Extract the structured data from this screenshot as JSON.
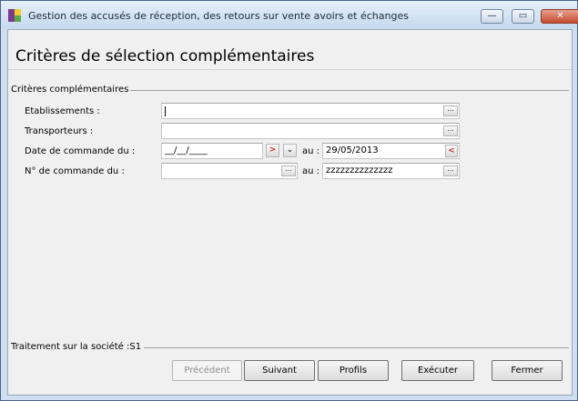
{
  "window": {
    "title": "Gestion des accusés de réception, des retours sur vente avoirs et échanges",
    "minimize_glyph": "—",
    "maximize_glyph": "▭",
    "close_glyph": "✕"
  },
  "page_title": "Critères de sélection complémentaires",
  "criteria": {
    "group_label": "Critères complémentaires",
    "etablissements": {
      "label": "Etablissements :",
      "value": ""
    },
    "transporteurs": {
      "label": "Transporteurs :",
      "value": ""
    },
    "date_commande": {
      "label": "Date de commande du :",
      "from_value": "__/__/____",
      "to_label": "au :",
      "to_value": "29/05/2013"
    },
    "num_commande": {
      "label": "N° de commande du :",
      "from_value": "",
      "to_label": "au :",
      "to_value": "zzzzzzzzzzzzzz"
    },
    "ellipsis_glyph": "...",
    "next_glyph": ">",
    "prev_glyph": "<",
    "dropdown_glyph": "⌄"
  },
  "footer": {
    "company_label": "Traitement sur la société :S1",
    "buttons": {
      "precedent": "Précédent",
      "suivant": "Suivant",
      "profils": "Profils",
      "executer": "Exécuter",
      "fermer": "Fermer"
    }
  },
  "colors": {
    "title_bar_top": "#e6effa",
    "close_button": "#c6492f",
    "calendar_arrow": "#c8321c"
  }
}
